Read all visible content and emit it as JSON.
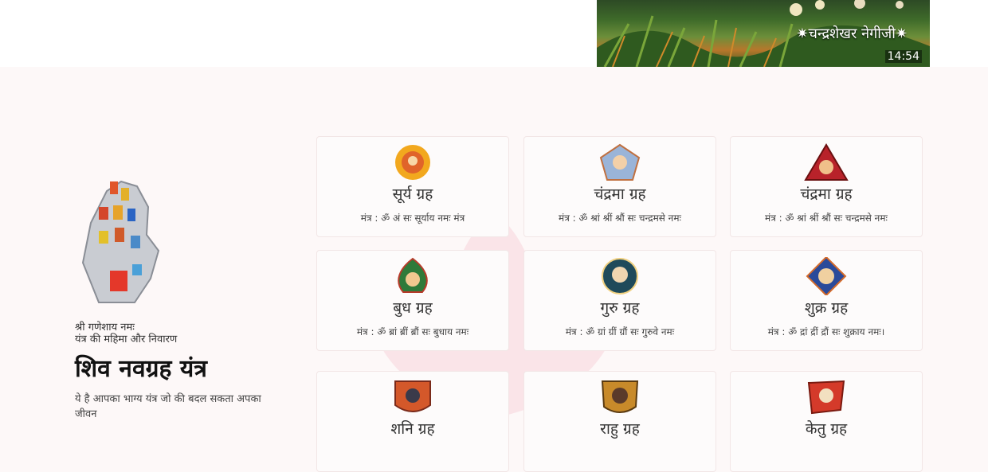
{
  "video": {
    "title": "✷चन्द्रशेखर नेगीजी✷",
    "duration": "14:54"
  },
  "left": {
    "invocation": "श्री गणेशाय नमः",
    "subtitle": "यंत्र की महिमा और निवारण",
    "title": "शिव नवग्रह यंत्र",
    "description": "ये है आपका भाग्य यंत्र जो की बदल सकता अपका जीवन"
  },
  "planets": [
    {
      "name": "सूर्य ग्रह",
      "mantra": "मंत्र : ॐ अं सः सूर्याय नमः मंत्र",
      "icon": "sun-deity-icon"
    },
    {
      "name": "चंद्रमा ग्रह",
      "mantra": "मंत्र : ॐ श्रां श्रीं श्रौं सः चन्द्रमसे नमः",
      "icon": "moon-deity-icon"
    },
    {
      "name": "चंद्रमा ग्रह",
      "mantra": "मंत्र : ॐ श्रां श्रीं श्रौं सः चन्द्रमसे नमः",
      "icon": "mars-deity-icon"
    },
    {
      "name": "बुध ग्रह",
      "mantra": "मंत्र : ॐ ब्रां ब्रीं ब्रौं सः बुधाय नमः",
      "icon": "mercury-deity-icon"
    },
    {
      "name": "गुरु ग्रह",
      "mantra": "मंत्र : ॐ ग्रां ग्रीं ग्रौं सः गुरुवे नमः",
      "icon": "jupiter-deity-icon"
    },
    {
      "name": "शुक्र ग्रह",
      "mantra": "मंत्र : ॐ द्रां द्रीं द्रौं सः शुक्राय नमः।",
      "icon": "venus-deity-icon"
    },
    {
      "name": "शनि ग्रह",
      "mantra": "",
      "icon": "saturn-deity-icon"
    },
    {
      "name": "राहु ग्रह",
      "mantra": "",
      "icon": "rahu-deity-icon"
    },
    {
      "name": "केतु ग्रह",
      "mantra": "",
      "icon": "ketu-deity-icon"
    }
  ]
}
